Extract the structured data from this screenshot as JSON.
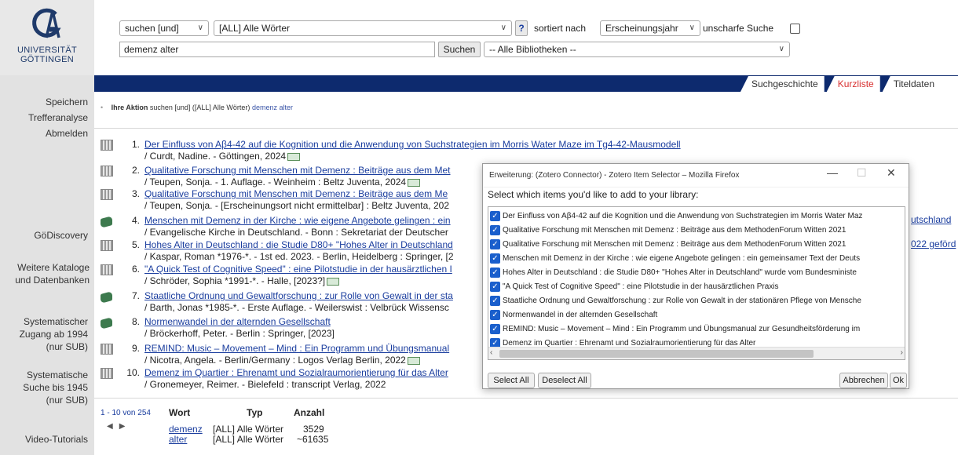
{
  "header": {
    "logo_text_line1": "UNIVERSITÄT",
    "logo_text_line2": "GÖTTINGEN",
    "logo_icon": "ga-logo-icon",
    "search_mode": "suchen [und]",
    "search_field": "[ALL] Alle Wörter",
    "help_label": "?",
    "sort_label": "sortiert nach",
    "sort_value": "Erscheinungsjahr",
    "fuzzy_label": "unscharfe Suche",
    "query": "demenz alter",
    "search_button": "Suchen",
    "library_select": "-- Alle Bibliotheken --"
  },
  "tabs": [
    {
      "label": "Suchgeschichte",
      "active": false
    },
    {
      "label": "Kurzliste",
      "active": true
    },
    {
      "label": "Titeldaten",
      "active": false
    }
  ],
  "sidebar": {
    "speichern": "Speichern",
    "trefferanalyse": "Trefferanalyse",
    "abmelden": "Abmelden",
    "godiscovery": "GöDiscovery",
    "weitere_kataloge_1": "Weitere Kataloge",
    "weitere_kataloge_2": "und Datenbanken",
    "systematischer_1": "Systematischer",
    "systematischer_2": "Zugang ab 1994",
    "systematischer_3": "(nur SUB)",
    "systematische_1": "Systematische",
    "systematische_2": "Suche bis 1945",
    "systematische_3": "(nur SUB)",
    "video": "Video-Tutorials"
  },
  "action": {
    "label": "Ihre Aktion",
    "text": "suchen [und] ([ALL] Alle Wörter)",
    "query": "demenz alter"
  },
  "results": [
    {
      "num": "1.",
      "icon": "film",
      "title": "Der Einfluss von Aβ4-42 auf die Kognition und die Anwendung von Suchstrategien im Morris Water Maze im Tg4-42-Mausmodell",
      "meta": "/ Curdt, Nadine. - Göttingen, 2024"
    },
    {
      "num": "2.",
      "icon": "film",
      "title": "Qualitative Forschung mit Menschen mit Demenz : Beiträge aus dem Met",
      "meta": "/ Teupen, Sonja. - 1. Auflage. - Weinheim : Beltz Juventa, 2024"
    },
    {
      "num": "3.",
      "icon": "film",
      "title": "Qualitative Forschung mit Menschen mit Demenz : Beiträge aus dem Me",
      "meta": "/ Teupen, Sonja. - [Erscheinungsort nicht ermittelbar] : Beltz Juventa, 202"
    },
    {
      "num": "4.",
      "icon": "book",
      "title": "Menschen mit Demenz in der Kirche : wie eigene Angebote gelingen : ein",
      "meta": "/ Evangelische Kirche in Deutschland. - Bonn : Sekretariat der Deutscher",
      "tail": "utschland"
    },
    {
      "num": "5.",
      "icon": "film",
      "title": "Hohes Alter in Deutschland : die Studie D80+ \"Hohes Alter in Deutschland",
      "meta": "/ Kaspar, Roman *1976-*. - 1st ed. 2023. - Berlin, Heidelberg : Springer, [2",
      "tail": "022 geförd"
    },
    {
      "num": "6.",
      "icon": "film",
      "title": "\"A Quick Test of Cognitive Speed\" : eine Pilotstudie in der hausärztlichen I",
      "meta": "/ Schröder, Sophia *1991-*. - Halle, [2023?]"
    },
    {
      "num": "7.",
      "icon": "book",
      "title": "Staatliche Ordnung und Gewaltforschung : zur Rolle von Gewalt in der sta",
      "meta": "/ Barth, Jonas *1985-*. - Erste Auflage. - Weilerswist : Velbrück Wissensc"
    },
    {
      "num": "8.",
      "icon": "book",
      "title": "Normenwandel in der alternden Gesellschaft",
      "meta": "/ Bröckerhoff, Peter. - Berlin : Springer, [2023]"
    },
    {
      "num": "9.",
      "icon": "film",
      "title": "REMIND: Music – Movement – Mind : Ein Programm und Übungsmanual",
      "meta": "/ Nicotra, Angela. - Berlin/Germany : Logos Verlag Berlin, 2022"
    },
    {
      "num": "10.",
      "icon": "film",
      "title": "Demenz im Quartier : Ehrenamt und Sozialraumorientierung für das Alter",
      "meta": "/ Gronemeyer, Reimer. - Bielefeld : transcript Verlag, 2022"
    }
  ],
  "pager": {
    "text": "1 - 10 von 254",
    "prev": "◀",
    "next": "▶"
  },
  "term_table": {
    "headers": [
      "Wort",
      "Typ",
      "Anzahl"
    ],
    "rows": [
      {
        "wort": "demenz",
        "typ": "[ALL] Alle Wörter",
        "anzahl": "3529"
      },
      {
        "wort": "alter",
        "typ": "[ALL] Alle Wörter",
        "anzahl": "~61635"
      }
    ]
  },
  "dialog": {
    "title": "Erweiterung: (Zotero Connector) - Zotero Item Selector – Mozilla Firefox",
    "minimize": "—",
    "maximize": "☐",
    "close": "✕",
    "prompt": "Select which items you'd like to add to your library:",
    "items": [
      "Der Einfluss von Aβ4-42 auf die Kognition und die Anwendung von Suchstrategien im Morris Water Maz",
      "Qualitative Forschung mit Menschen mit Demenz : Beiträge aus dem MethodenForum Witten 2021",
      "Qualitative Forschung mit Menschen mit Demenz : Beiträge aus dem MethodenForum Witten 2021",
      "Menschen mit Demenz in der Kirche : wie eigene Angebote gelingen : ein gemeinsamer Text der Deuts",
      "Hohes Alter in Deutschland : die Studie D80+ \"Hohes Alter in Deutschland\" wurde vom Bundesministe",
      "\"A Quick Test of Cognitive Speed\" : eine Pilotstudie in der hausärztlichen Praxis",
      "Staatliche Ordnung und Gewaltforschung : zur Rolle von Gewalt in der stationären Pflege von Mensche",
      "Normenwandel in der alternden Gesellschaft",
      "REMIND: Music – Movement – Mind : Ein Programm und Übungsmanual zur Gesundheitsförderung im",
      "Demenz im Quartier : Ehrenamt und Sozialraumorientierung für das Alter"
    ],
    "select_all": "Select All",
    "deselect_all": "Deselect All",
    "cancel": "Abbrechen",
    "ok": "Ok"
  },
  "colors": {
    "navy": "#0d2a6e",
    "active_tab": "#d83030",
    "link": "#1a3d9e",
    "checkbox": "#1a5fcc"
  }
}
